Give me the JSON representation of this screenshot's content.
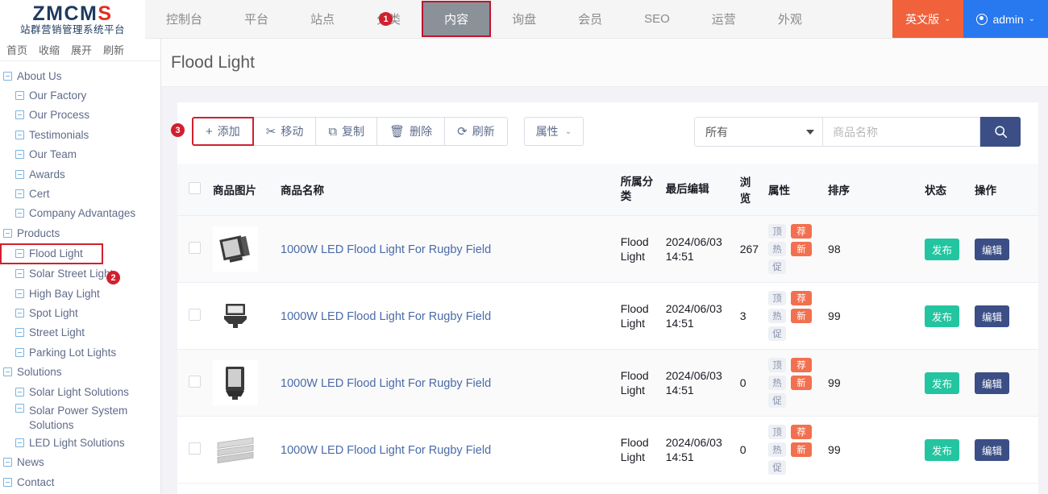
{
  "brand": {
    "logo_prefix": "ZMCM",
    "logo_suffix": "S",
    "subtitle": "站群营销管理系统平台"
  },
  "topnav": {
    "items": [
      {
        "label": "控制台",
        "active": false
      },
      {
        "label": "平台",
        "active": false
      },
      {
        "label": "站点",
        "active": false
      },
      {
        "label": "分类",
        "active": false
      },
      {
        "label": "内容",
        "active": true
      },
      {
        "label": "询盘",
        "active": false
      },
      {
        "label": "会员",
        "active": false
      },
      {
        "label": "SEO",
        "active": false
      },
      {
        "label": "运营",
        "active": false
      },
      {
        "label": "外观",
        "active": false
      }
    ],
    "lang_label": "英文版",
    "admin_label": "admin",
    "caret": "⌄"
  },
  "annotations": {
    "one": "1",
    "two": "2",
    "three": "3"
  },
  "sidebar": {
    "tools": [
      "首页",
      "收缩",
      "展开",
      "刷新"
    ],
    "tree": [
      {
        "label": "About Us",
        "level": 0,
        "selected": false
      },
      {
        "label": "Our Factory",
        "level": 1,
        "selected": false
      },
      {
        "label": "Our Process",
        "level": 1,
        "selected": false
      },
      {
        "label": "Testimonials",
        "level": 1,
        "selected": false
      },
      {
        "label": "Our Team",
        "level": 1,
        "selected": false
      },
      {
        "label": "Awards",
        "level": 1,
        "selected": false
      },
      {
        "label": "Cert",
        "level": 1,
        "selected": false
      },
      {
        "label": "Company Advantages",
        "level": 1,
        "selected": false
      },
      {
        "label": "Products",
        "level": 0,
        "selected": false
      },
      {
        "label": "Flood Light",
        "level": 1,
        "selected": true
      },
      {
        "label": "Solar Street Light",
        "level": 1,
        "selected": false
      },
      {
        "label": "High Bay Light",
        "level": 1,
        "selected": false
      },
      {
        "label": "Spot Light",
        "level": 1,
        "selected": false
      },
      {
        "label": "Street Light",
        "level": 1,
        "selected": false
      },
      {
        "label": "Parking Lot Lights",
        "level": 1,
        "selected": false
      },
      {
        "label": "Solutions",
        "level": 0,
        "selected": false
      },
      {
        "label": "Solar Light Solutions",
        "level": 1,
        "selected": false
      },
      {
        "label": "Solar Power System Solutions",
        "level": 1,
        "selected": false,
        "wrap": true
      },
      {
        "label": "LED Light Solutions",
        "level": 1,
        "selected": false
      },
      {
        "label": "News",
        "level": 0,
        "selected": false
      },
      {
        "label": "Contact",
        "level": 0,
        "selected": false
      }
    ]
  },
  "page": {
    "title": "Flood Light"
  },
  "toolbar": {
    "buttons": [
      {
        "label": "添加",
        "icon": "plus-icon",
        "glyph": "+",
        "highlighted": true
      },
      {
        "label": "移动",
        "icon": "scissors-icon",
        "glyph": "✂",
        "highlighted": false
      },
      {
        "label": "复制",
        "icon": "copy-icon",
        "glyph": "⧉",
        "highlighted": false
      },
      {
        "label": "删除",
        "icon": "trash-icon",
        "glyph": "🗑",
        "highlighted": false
      },
      {
        "label": "刷新",
        "icon": "refresh-icon",
        "glyph": "⟳",
        "highlighted": false
      }
    ],
    "attribute_label": "属性",
    "attribute_caret": "⌄"
  },
  "search": {
    "select_value": "所有",
    "placeholder": "商品名称",
    "input_value": "",
    "search_icon": "search-icon"
  },
  "table": {
    "columns": [
      "商品图片",
      "商品名称",
      "所属分类",
      "最后编辑",
      "浏览",
      "属性",
      "排序",
      "状态",
      "操作"
    ],
    "rows": [
      {
        "name": "1000W LED Flood Light For Rugby Field",
        "category": "Flood Light",
        "edited": "2024/06/03 14:51",
        "views": "267",
        "attrs": [
          {
            "label": "顶",
            "type": "gray"
          },
          {
            "label": "荐",
            "type": "orange"
          },
          {
            "label": "热",
            "type": "gray"
          },
          {
            "label": "新",
            "type": "orange"
          },
          {
            "label": "促",
            "type": "gray"
          }
        ],
        "sort": "98",
        "state": "发布",
        "action": "编辑",
        "thumb": "floodlight-square-icon"
      },
      {
        "name": "1000W LED Flood Light For Rugby Field",
        "category": "Flood Light",
        "edited": "2024/06/03 14:51",
        "views": "3",
        "attrs": [
          {
            "label": "顶",
            "type": "gray"
          },
          {
            "label": "荐",
            "type": "orange"
          },
          {
            "label": "热",
            "type": "gray"
          },
          {
            "label": "新",
            "type": "orange"
          },
          {
            "label": "促",
            "type": "gray"
          }
        ],
        "sort": "99",
        "state": "发布",
        "action": "编辑",
        "thumb": "floodlight-bracket-icon"
      },
      {
        "name": "1000W LED Flood Light For Rugby Field",
        "category": "Flood Light",
        "edited": "2024/06/03 14:51",
        "views": "0",
        "attrs": [
          {
            "label": "顶",
            "type": "gray"
          },
          {
            "label": "荐",
            "type": "orange"
          },
          {
            "label": "热",
            "type": "gray"
          },
          {
            "label": "新",
            "type": "orange"
          },
          {
            "label": "促",
            "type": "gray"
          }
        ],
        "sort": "99",
        "state": "发布",
        "action": "编辑",
        "thumb": "floodlight-tall-icon"
      },
      {
        "name": "1000W LED Flood Light For Rugby Field",
        "category": "Flood Light",
        "edited": "2024/06/03 14:51",
        "views": "0",
        "attrs": [
          {
            "label": "顶",
            "type": "gray"
          },
          {
            "label": "荐",
            "type": "orange"
          },
          {
            "label": "热",
            "type": "gray"
          },
          {
            "label": "新",
            "type": "orange"
          },
          {
            "label": "促",
            "type": "gray"
          }
        ],
        "sort": "99",
        "state": "发布",
        "action": "编辑",
        "thumb": "floodlight-panel-icon"
      }
    ]
  },
  "colors": {
    "accent_red": "#d0202e",
    "lang_orange": "#f0613c",
    "admin_blue": "#2878f0",
    "search_navy": "#3b4f86",
    "publish_green": "#23c5a0",
    "badge_orange": "#f2704f"
  }
}
